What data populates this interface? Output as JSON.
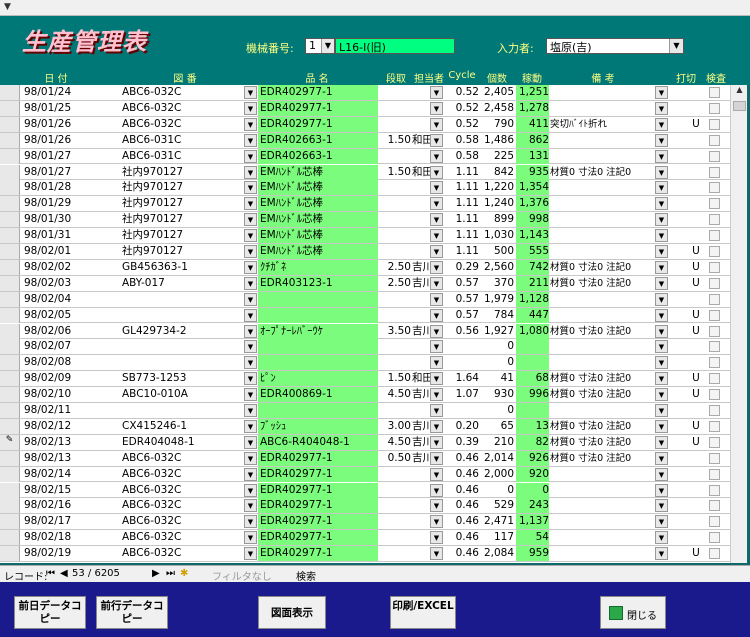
{
  "header": {
    "title": "生産管理表",
    "machine_label": "機械番号:",
    "machine_value": "1",
    "machine_name": "L16-Ⅰ(旧)",
    "operator_label": "入力者:",
    "operator_value": "塩原(吉)"
  },
  "columns": [
    "日 付",
    "図 番",
    "品 名",
    "段取",
    "担当者",
    "Cycle",
    "個数",
    "稼動",
    "備 考",
    "打切",
    "検査"
  ],
  "rows": [
    {
      "date": "98/01/24",
      "drawing": "ABC6-032C",
      "product": "EDR402977-1",
      "setup": "",
      "operator": "",
      "cycle": "0.52",
      "qty": "2,405",
      "uptime": "1,251",
      "note": "",
      "cut": ""
    },
    {
      "date": "98/01/25",
      "drawing": "ABC6-032C",
      "product": "EDR402977-1",
      "setup": "",
      "operator": "",
      "cycle": "0.52",
      "qty": "2,458",
      "uptime": "1,278",
      "note": "",
      "cut": ""
    },
    {
      "date": "98/01/26",
      "drawing": "ABC6-032C",
      "product": "EDR402977-1",
      "setup": "",
      "operator": "",
      "cycle": "0.52",
      "qty": "790",
      "uptime": "411",
      "note": "突切ﾊﾞｲﾄ折れ",
      "cut": "U"
    },
    {
      "date": "98/01/26",
      "drawing": "ABC6-031C",
      "product": "EDR402663-1",
      "setup": "1.50",
      "operator": "和田",
      "cycle": "0.58",
      "qty": "1,486",
      "uptime": "862",
      "note": "",
      "cut": ""
    },
    {
      "date": "98/01/27",
      "drawing": "ABC6-031C",
      "product": "EDR402663-1",
      "setup": "",
      "operator": "",
      "cycle": "0.58",
      "qty": "225",
      "uptime": "131",
      "note": "",
      "cut": ""
    },
    {
      "date": "98/01/27",
      "drawing": "社内970127",
      "product": "EMﾊﾝﾄﾞﾙ芯棒",
      "setup": "1.50",
      "operator": "和田",
      "cycle": "1.11",
      "qty": "842",
      "uptime": "935",
      "note": "材質0 寸法0 注記0",
      "cut": ""
    },
    {
      "date": "98/01/28",
      "drawing": "社内970127",
      "product": "EMﾊﾝﾄﾞﾙ芯棒",
      "setup": "",
      "operator": "",
      "cycle": "1.11",
      "qty": "1,220",
      "uptime": "1,354",
      "note": "",
      "cut": ""
    },
    {
      "date": "98/01/29",
      "drawing": "社内970127",
      "product": "EMﾊﾝﾄﾞﾙ芯棒",
      "setup": "",
      "operator": "",
      "cycle": "1.11",
      "qty": "1,240",
      "uptime": "1,376",
      "note": "",
      "cut": ""
    },
    {
      "date": "98/01/30",
      "drawing": "社内970127",
      "product": "EMﾊﾝﾄﾞﾙ芯棒",
      "setup": "",
      "operator": "",
      "cycle": "1.11",
      "qty": "899",
      "uptime": "998",
      "note": "",
      "cut": ""
    },
    {
      "date": "98/01/31",
      "drawing": "社内970127",
      "product": "EMﾊﾝﾄﾞﾙ芯棒",
      "setup": "",
      "operator": "",
      "cycle": "1.11",
      "qty": "1,030",
      "uptime": "1,143",
      "note": "",
      "cut": ""
    },
    {
      "date": "98/02/01",
      "drawing": "社内970127",
      "product": "EMﾊﾝﾄﾞﾙ芯棒",
      "setup": "",
      "operator": "",
      "cycle": "1.11",
      "qty": "500",
      "uptime": "555",
      "note": "",
      "cut": "U"
    },
    {
      "date": "98/02/02",
      "drawing": "GB456363-1",
      "product": "ｸﾁｶﾞﾈ",
      "setup": "2.50",
      "operator": "吉川",
      "cycle": "0.29",
      "qty": "2,560",
      "uptime": "742",
      "note": "材質0 寸法0 注記0",
      "cut": "U"
    },
    {
      "date": "98/02/03",
      "drawing": "ABY-017",
      "product": "EDR403123-1",
      "setup": "2.50",
      "operator": "吉川",
      "cycle": "0.57",
      "qty": "370",
      "uptime": "211",
      "note": "材質0 寸法0 注記0",
      "cut": "U"
    },
    {
      "date": "98/02/04",
      "drawing": "",
      "product": "",
      "setup": "",
      "operator": "",
      "cycle": "0.57",
      "qty": "1,979",
      "uptime": "1,128",
      "note": "",
      "cut": ""
    },
    {
      "date": "98/02/05",
      "drawing": "",
      "product": "",
      "setup": "",
      "operator": "",
      "cycle": "0.57",
      "qty": "784",
      "uptime": "447",
      "note": "",
      "cut": "U"
    },
    {
      "date": "98/02/06",
      "drawing": "GL429734-2",
      "product": "ｵｰﾌﾟﾅｰﾚﾊﾞｰｳｹ",
      "setup": "3.50",
      "operator": "吉川",
      "cycle": "0.56",
      "qty": "1,927",
      "uptime": "1,080",
      "note": "材質0 寸法0 注記0",
      "cut": "U"
    },
    {
      "date": "98/02/07",
      "drawing": "",
      "product": "",
      "setup": "",
      "operator": "",
      "cycle": "",
      "qty": "0",
      "uptime": "",
      "note": "",
      "cut": ""
    },
    {
      "date": "98/02/08",
      "drawing": "",
      "product": "",
      "setup": "",
      "operator": "",
      "cycle": "",
      "qty": "0",
      "uptime": "",
      "note": "",
      "cut": ""
    },
    {
      "date": "98/02/09",
      "drawing": "SB773-1253",
      "product": "ﾋﾟﾝ",
      "setup": "1.50",
      "operator": "和田",
      "cycle": "1.64",
      "qty": "41",
      "uptime": "68",
      "note": "材質0 寸法0 注記0",
      "cut": "U"
    },
    {
      "date": "98/02/10",
      "drawing": "ABC10-010A",
      "product": "EDR400869-1",
      "setup": "4.50",
      "operator": "吉川",
      "cycle": "1.07",
      "qty": "930",
      "uptime": "996",
      "note": "材質0 寸法0 注記0",
      "cut": "U"
    },
    {
      "date": "98/02/11",
      "drawing": "",
      "product": "",
      "setup": "",
      "operator": "",
      "cycle": "",
      "qty": "0",
      "uptime": "",
      "note": "",
      "cut": ""
    },
    {
      "date": "98/02/12",
      "drawing": "CX415246-1",
      "product": "ﾌﾞｯｼｭ",
      "setup": "3.00",
      "operator": "吉川",
      "cycle": "0.20",
      "qty": "65",
      "uptime": "13",
      "note": "材質0 寸法0 注記0",
      "cut": "U"
    },
    {
      "date": "98/02/13",
      "drawing": "EDR404048-1",
      "product": "ABC6-R404048-1",
      "setup": "4.50",
      "operator": "吉川",
      "cycle": "0.39",
      "qty": "210",
      "uptime": "82",
      "note": "材質0 寸法0 注記0",
      "cut": "U"
    },
    {
      "date": "98/02/13",
      "drawing": "ABC6-032C",
      "product": "EDR402977-1",
      "setup": "0.50",
      "operator": "吉川",
      "cycle": "0.46",
      "qty": "2,014",
      "uptime": "926",
      "note": "材質0 寸法0 注記0",
      "cut": ""
    },
    {
      "date": "98/02/14",
      "drawing": "ABC6-032C",
      "product": "EDR402977-1",
      "setup": "",
      "operator": "",
      "cycle": "0.46",
      "qty": "2,000",
      "uptime": "920",
      "note": "",
      "cut": ""
    },
    {
      "date": "98/02/15",
      "drawing": "ABC6-032C",
      "product": "EDR402977-1",
      "setup": "",
      "operator": "",
      "cycle": "0.46",
      "qty": "0",
      "uptime": "0",
      "note": "",
      "cut": ""
    },
    {
      "date": "98/02/16",
      "drawing": "ABC6-032C",
      "product": "EDR402977-1",
      "setup": "",
      "operator": "",
      "cycle": "0.46",
      "qty": "529",
      "uptime": "243",
      "note": "",
      "cut": ""
    },
    {
      "date": "98/02/17",
      "drawing": "ABC6-032C",
      "product": "EDR402977-1",
      "setup": "",
      "operator": "",
      "cycle": "0.46",
      "qty": "2,471",
      "uptime": "1,137",
      "note": "",
      "cut": ""
    },
    {
      "date": "98/02/18",
      "drawing": "ABC6-032C",
      "product": "EDR402977-1",
      "setup": "",
      "operator": "",
      "cycle": "0.46",
      "qty": "117",
      "uptime": "54",
      "note": "",
      "cut": ""
    },
    {
      "date": "98/02/19",
      "drawing": "ABC6-032C",
      "product": "EDR402977-1",
      "setup": "",
      "operator": "",
      "cycle": "0.46",
      "qty": "2,084",
      "uptime": "959",
      "note": "",
      "cut": "U"
    }
  ],
  "navigation": {
    "record_label": "レコード:",
    "current": "53 / 6205",
    "filter": "フィルタなし",
    "search": "検索"
  },
  "buttons": {
    "prev_day": "前日データコピー",
    "prev_row": "前行データコピー",
    "drawing": "図面表示",
    "print": "印刷/EXCEL",
    "close": "閉じる"
  },
  "colors": {
    "header_bg": "#007878",
    "header_text": "#ffff80",
    "green_fill": "#7cfc7c",
    "bottom_bg": "#1a1a8c",
    "title": "#ffc0d0"
  }
}
